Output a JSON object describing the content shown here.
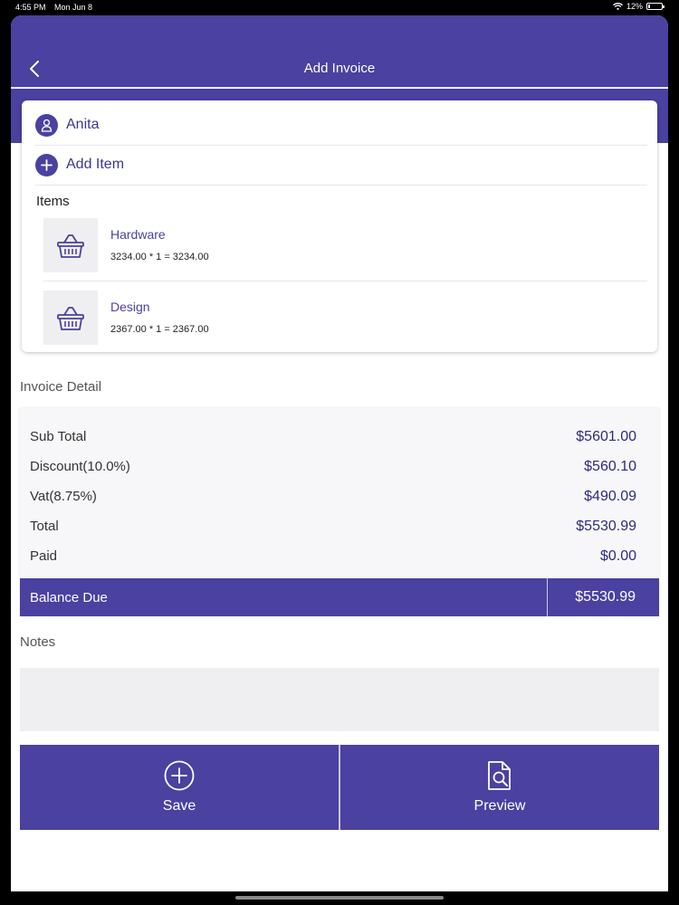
{
  "status_bar": {
    "time": "4:55 PM",
    "date": "Mon Jun 8",
    "battery": "12%",
    "battery_level": 0.12
  },
  "nav": {
    "title": "Add Invoice"
  },
  "customer": {
    "name": "Anita"
  },
  "add_item": {
    "label": "Add Item"
  },
  "items_section": {
    "label": "Items"
  },
  "items": [
    {
      "name": "Hardware",
      "calc": "3234.00 * 1 = 3234.00"
    },
    {
      "name": "Design",
      "calc": "2367.00 * 1 = 2367.00"
    }
  ],
  "invoice_detail": {
    "label": "Invoice Detail",
    "rows": [
      {
        "label": "Sub Total",
        "value": "$5601.00"
      },
      {
        "label": "Discount(10.0%)",
        "value": "$560.10"
      },
      {
        "label": "Vat(8.75%)",
        "value": "$490.09"
      },
      {
        "label": "Total",
        "value": "$5530.99"
      },
      {
        "label": "Paid",
        "value": "$0.00"
      }
    ],
    "balance_label": "Balance Due",
    "balance_value": "$5530.99"
  },
  "notes": {
    "label": "Notes",
    "value": ""
  },
  "actions": {
    "save": "Save",
    "preview": "Preview"
  },
  "colors": {
    "primary": "#4a41a0",
    "accent_text": "#2e2a82",
    "panel_bg": "#efeff1"
  }
}
